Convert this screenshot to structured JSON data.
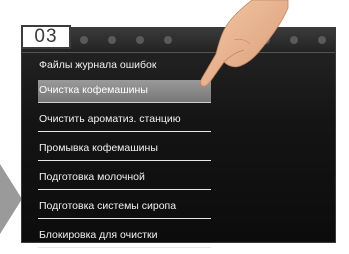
{
  "step_badge": "03",
  "menu": {
    "items": [
      {
        "label": "Файлы журнала ошибок",
        "selected": false
      },
      {
        "label": "Очистка кофемашины",
        "selected": true
      },
      {
        "label": "Очистить ароматиз. станцию",
        "selected": false
      },
      {
        "label": "Промывка кофемашины",
        "selected": false
      },
      {
        "label": "Подготовка молочной",
        "selected": false
      },
      {
        "label": "Подготовка системы сиропа",
        "selected": false
      },
      {
        "label": "Блокировка для очистки",
        "selected": false
      }
    ]
  },
  "colors": {
    "screen_bg": "#141414",
    "selected_bg": "#8a8a8a",
    "text": "#f2f2f2",
    "badge_border": "#3c3c3c",
    "arrow": "#9a9a9a"
  }
}
